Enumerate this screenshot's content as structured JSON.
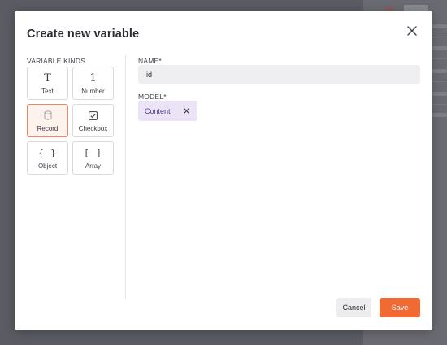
{
  "dialog": {
    "title": "Create new variable"
  },
  "variable_kinds": {
    "label": "VARIABLE KINDS",
    "items": [
      {
        "label": "Text",
        "icon": "text-icon",
        "selected": false
      },
      {
        "label": "Number",
        "icon": "number-icon",
        "selected": false
      },
      {
        "label": "Record",
        "icon": "record-icon",
        "selected": true
      },
      {
        "label": "Checkbox",
        "icon": "checkbox-icon",
        "selected": false
      },
      {
        "label": "Object",
        "icon": "object-braces-icon",
        "selected": false
      },
      {
        "label": "Array",
        "icon": "array-brackets-icon",
        "selected": false
      }
    ]
  },
  "name_field": {
    "label": "NAME*",
    "value": "id"
  },
  "model_field": {
    "label": "MODEL*",
    "tag": "Content"
  },
  "actions": {
    "cancel": "Cancel",
    "save": "Save"
  },
  "colors": {
    "accent": "#f26a33",
    "selected_border": "#f3845c",
    "tag_bg": "#ebe4f6"
  }
}
